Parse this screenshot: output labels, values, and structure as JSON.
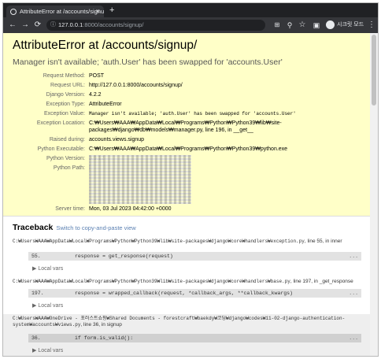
{
  "browser": {
    "tab_title": "AttributeError at /accounts/signu",
    "url_host": "127.0.0.1",
    "url_path": ":8000/accounts/signup/",
    "profile_label": "시크릿 모드",
    "new_tab": "+",
    "tab_close": "×"
  },
  "error": {
    "title": "AttributeError at /accounts/signup/",
    "value": "Manager isn't available; 'auth.User' has been swapped for 'accounts.User'"
  },
  "meta": {
    "rows": [
      {
        "key": "Request Method:",
        "value": "POST"
      },
      {
        "key": "Request URL:",
        "value": "http://127.0.0.1:8000/accounts/signup/"
      },
      {
        "key": "Django Version:",
        "value": "4.2.2"
      },
      {
        "key": "Exception Type:",
        "value": "AttributeError"
      },
      {
        "key": "Exception Value:",
        "value": "Manager isn't available; 'auth.User' has been swapped for 'accounts.User'"
      },
      {
        "key": "Exception Location:",
        "value": "C:₩Users₩AAA₩AppData₩Local₩Programs₩Python₩Python39₩lib₩site-packages₩django₩db₩models₩manager.py, line 196, in __get__"
      },
      {
        "key": "Raised during:",
        "value": "accounts.views.signup"
      },
      {
        "key": "Python Executable:",
        "value": "C:₩Users₩AAA₩AppData₩Local₩Programs₩Python₩Python39₩python.exe"
      },
      {
        "key": "Python Version:",
        "value": "3.9.12"
      },
      {
        "key": "Python Path:",
        "value": "["
      },
      {
        "key": "Server time:",
        "value": "Mon, 03 Jul 2023 04:42:00 +0000"
      }
    ]
  },
  "traceback": {
    "title": "Traceback",
    "switch_link": "Switch to copy-and-paste view",
    "frames": [
      {
        "path": "C:₩Users₩AAA₩AppData₩Local₩Programs₩Python₩Python39₩lib₩site-packages₩django₩core₩handlers₩exception.py",
        "suffix": ", line 55, in inner",
        "lineno": "55.",
        "code": "response = get_response(request)",
        "local_vars": "Local vars"
      },
      {
        "path": "C:₩Users₩AAA₩AppData₩Local₩Programs₩Python₩Python39₩lib₩site-packages₩django₩core₩handlers₩base.py",
        "suffix": ", line 197, in _get_response",
        "lineno": "197.",
        "code": "response = wrapped_callback(request, *callback_args, **callback_kwargs)",
        "local_vars": "Local vars"
      },
      {
        "path": "C:₩Users₩AAA₩OneDrive - 포러스트쇼핑₩Shared Documents - forestcraft₩baekdy₩코딩₩django₩codes₩11-02-django-authentication-system₩accounts₩views.py",
        "suffix": ", line 36, in signup",
        "lineno": "36.",
        "code": "if form.is_valid():",
        "local_vars": "Local vars"
      }
    ],
    "more": "..."
  }
}
